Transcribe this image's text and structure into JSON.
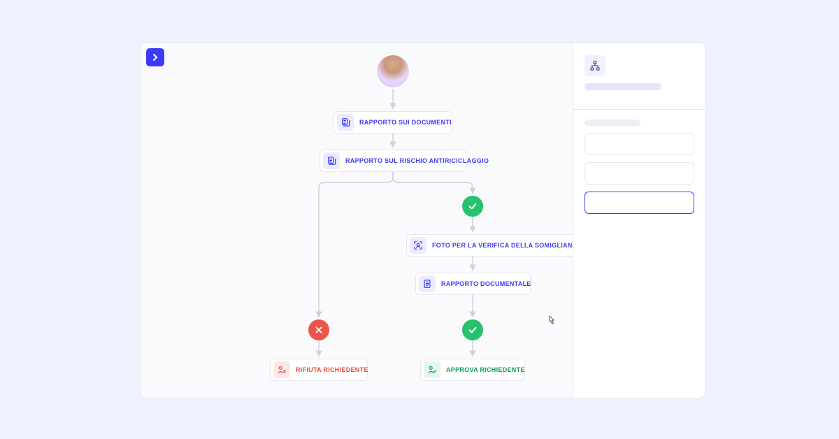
{
  "colors": {
    "accent": "#3b3bfb",
    "approve": "#27c26c",
    "reject": "#ec554a",
    "approve_text": "#0f9d58",
    "reject_text": "#e94b3c"
  },
  "steps": {
    "documents_report": "RAPPORTO SUI DOCUMENTI",
    "aml_risk_report": "RAPPORTO SUL RISCHIO ANTIRICICLAGGIO",
    "face_similarity_photo": "FOTO PER LA VERIFICA DELLA SOMIGLIANZA FACCIALE",
    "documentary_report": "RAPPORTO DOCUMENTALE",
    "reject_applicant": "RIFIUTA RICHIEDENTE",
    "approve_applicant": "APPROVA RICHIEDENTE"
  },
  "icons": {
    "sidebar_toggle": "chevron-right",
    "hierarchy": "flow-tree",
    "document": "file-stack",
    "face": "face-scan",
    "report": "file-check",
    "person_approve": "person-check",
    "person_reject": "person-x",
    "check": "check",
    "cross": "cross"
  }
}
